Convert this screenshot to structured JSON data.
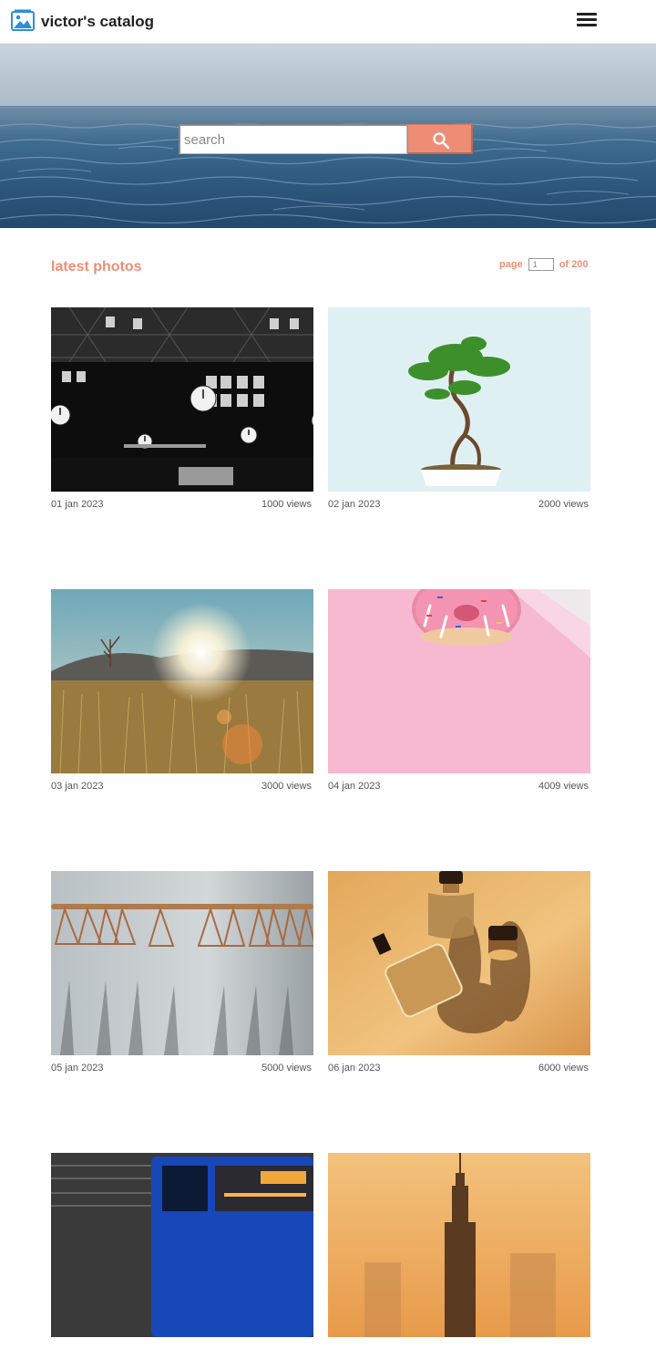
{
  "navbar": {
    "brand": "victor's catalog",
    "logo_icon": "image-gallery-icon",
    "menu_icon": "hamburger-menu-icon"
  },
  "search": {
    "placeholder": "search",
    "button_icon": "search-icon"
  },
  "section": {
    "title": "latest photos"
  },
  "pager": {
    "label": "page",
    "current": "1",
    "of_label": "of 200"
  },
  "photos": [
    {
      "date": "01 jan 2023",
      "views": "1000 views",
      "subject": "clocks"
    },
    {
      "date": "02 jan 2023",
      "views": "2000 views",
      "subject": "bonsai"
    },
    {
      "date": "03 jan 2023",
      "views": "3000 views",
      "subject": "sunset-field"
    },
    {
      "date": "04 jan 2023",
      "views": "4009 views",
      "subject": "donut"
    },
    {
      "date": "05 jan 2023",
      "views": "5000 views",
      "subject": "hangers"
    },
    {
      "date": "06 jan 2023",
      "views": "6000 views",
      "subject": "perfume"
    },
    {
      "date": "",
      "views": "",
      "subject": "bus"
    },
    {
      "date": "",
      "views": "",
      "subject": "skyline"
    }
  ],
  "colors": {
    "accent": "#ee8d76",
    "text": "#222222"
  }
}
